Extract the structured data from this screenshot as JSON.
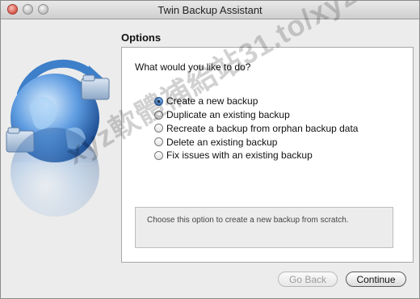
{
  "window": {
    "title": "Twin Backup Assistant"
  },
  "section": {
    "title": "Options"
  },
  "panel": {
    "question": "What would you like to do?",
    "options": [
      {
        "label": "Create a new backup",
        "selected": true
      },
      {
        "label": "Duplicate an existing backup",
        "selected": false
      },
      {
        "label": "Recreate a backup from orphan backup data",
        "selected": false
      },
      {
        "label": "Delete an existing backup",
        "selected": false
      },
      {
        "label": "Fix issues with an existing backup",
        "selected": false
      }
    ],
    "description": "Choose this option to create a new backup from scratch."
  },
  "buttons": {
    "back_label": "Go Back",
    "continue_label": "Continue"
  },
  "watermark": "xyz軟體補給站31.to/xyz",
  "icons": {
    "art": "globe-backup-icon"
  },
  "colors": {
    "radio_selected": "#3b78c6",
    "disabled_text": "#9b9b9b"
  }
}
